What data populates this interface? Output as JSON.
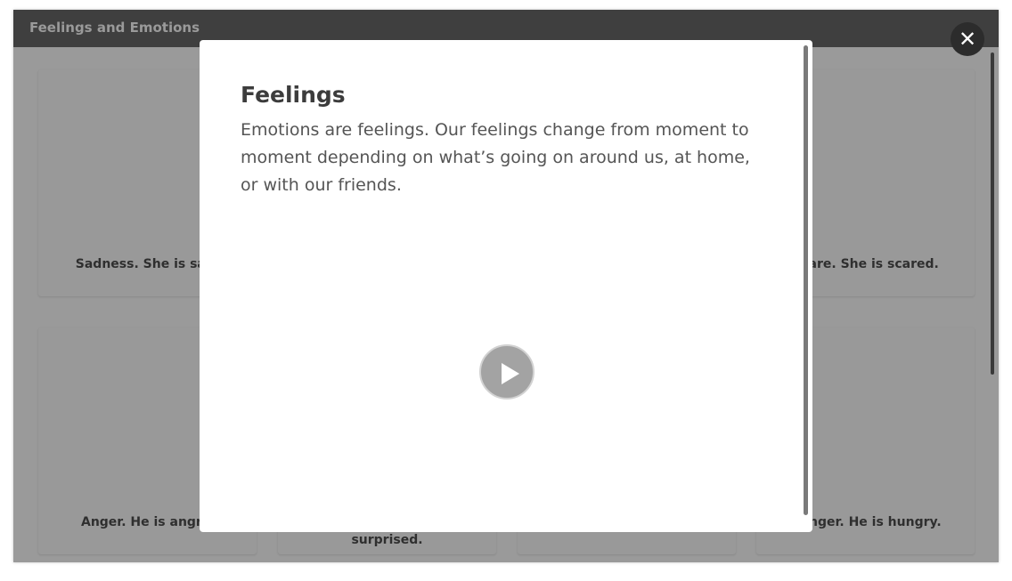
{
  "app": {
    "title": "Feelings and Emotions"
  },
  "cards": [
    {
      "caption": "Sadness. She is sad."
    },
    {
      "caption": ""
    },
    {
      "caption": ""
    },
    {
      "caption": "Scare. She is scared."
    },
    {
      "caption": "Anger. He is angry."
    },
    {
      "caption": "Surprise. She is surprised."
    },
    {
      "caption": ""
    },
    {
      "caption": "Hunger. He is hungry."
    }
  ],
  "modal": {
    "title": "Feelings",
    "body": "Emotions are feelings. Our feelings change from moment to moment depending on what’s going on around us, at home, or with our friends.",
    "close_symbol": "✕",
    "play_icon": "play-icon",
    "close_icon": "close-icon"
  },
  "colors": {
    "header_bg": "#3f3f3f",
    "overlay_bg": "#9a9a9a",
    "modal_bg": "#ffffff",
    "play_button": "#a3a3a3"
  }
}
